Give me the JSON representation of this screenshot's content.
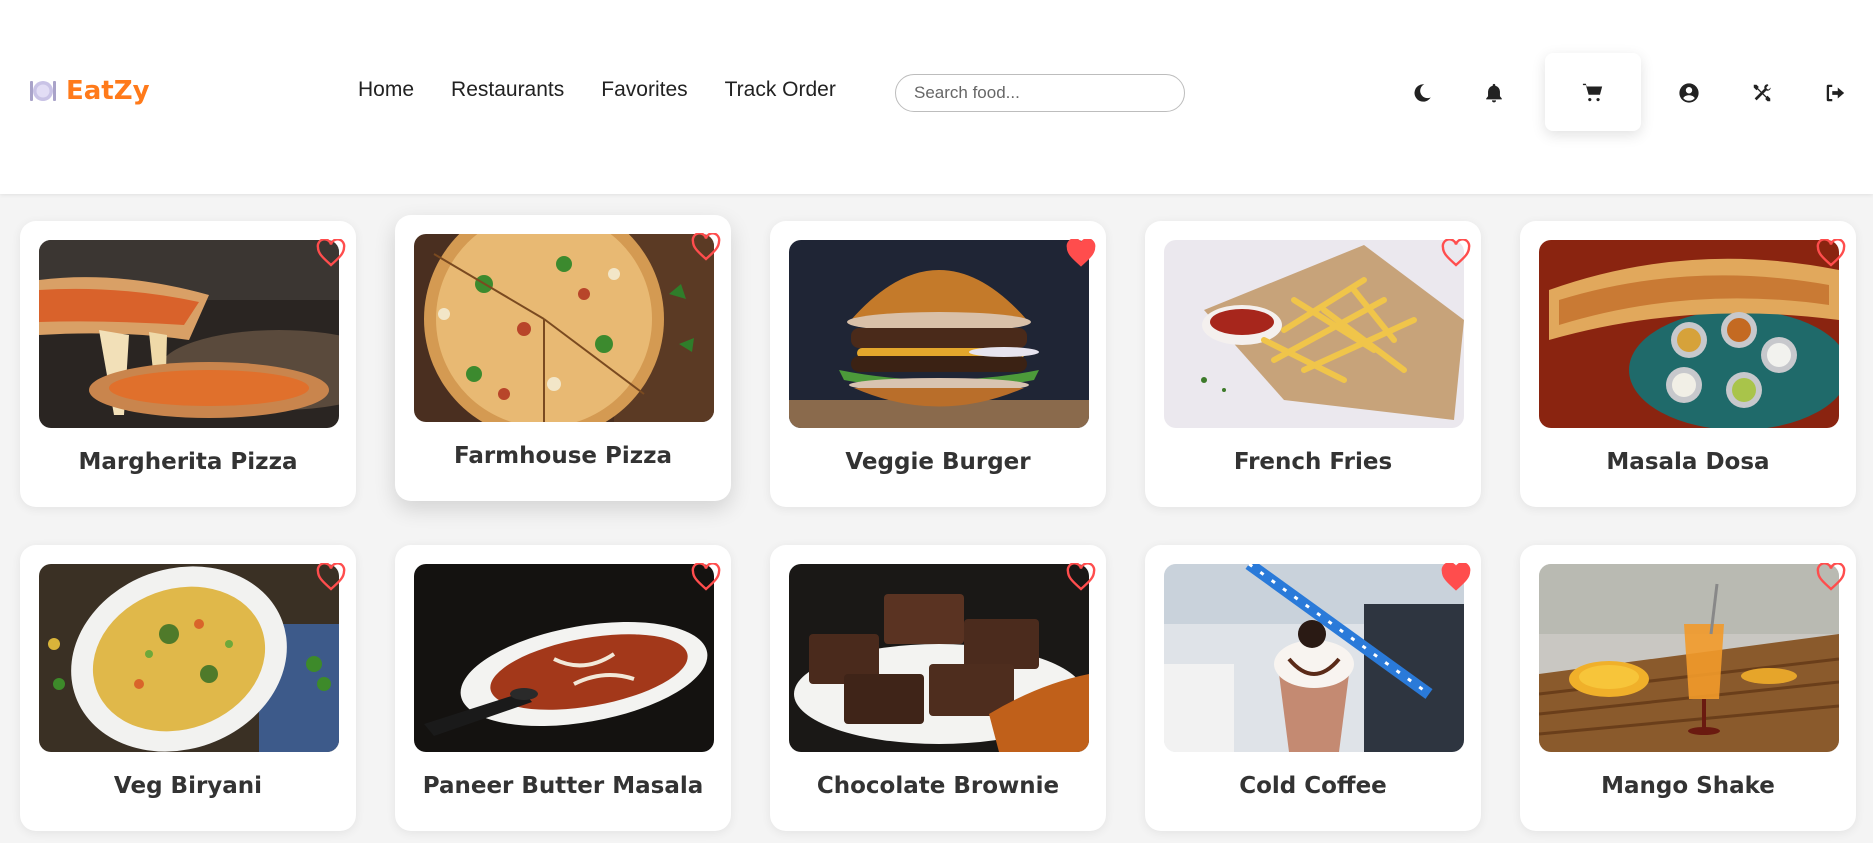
{
  "brand": {
    "name": "EatZy",
    "color": "#ff7a1a",
    "icon": "plate-cutlery-icon"
  },
  "nav": [
    {
      "label": "Home"
    },
    {
      "label": "Restaurants"
    },
    {
      "label": "Favorites"
    },
    {
      "label": "Track Order"
    }
  ],
  "search": {
    "placeholder": "Search food...",
    "value": ""
  },
  "header_icons": [
    "moon-icon",
    "bell-icon",
    "cart-icon",
    "user-circle-icon",
    "tools-icon",
    "logout-icon"
  ],
  "accent": {
    "favorite_red": "#ff4d4d",
    "text": "#333333"
  },
  "foods": [
    {
      "name": "Margherita Pizza",
      "favorite": false,
      "image": "pizza-cheese-pull"
    },
    {
      "name": "Farmhouse Pizza",
      "favorite": false,
      "image": "pizza-slices"
    },
    {
      "name": "Veggie Burger",
      "favorite": true,
      "image": "burger"
    },
    {
      "name": "French Fries",
      "favorite": false,
      "image": "fries-ketchup"
    },
    {
      "name": "Masala Dosa",
      "favorite": false,
      "image": "dosa-platter"
    },
    {
      "name": "Veg Biryani",
      "favorite": false,
      "image": "biryani-bowl"
    },
    {
      "name": "Paneer Butter Masala",
      "favorite": false,
      "image": "curry-dish"
    },
    {
      "name": "Chocolate Brownie",
      "favorite": false,
      "image": "brownie-plate"
    },
    {
      "name": "Cold Coffee",
      "favorite": true,
      "image": "milkshake-glass"
    },
    {
      "name": "Mango Shake",
      "favorite": false,
      "image": "mango-juice"
    }
  ]
}
